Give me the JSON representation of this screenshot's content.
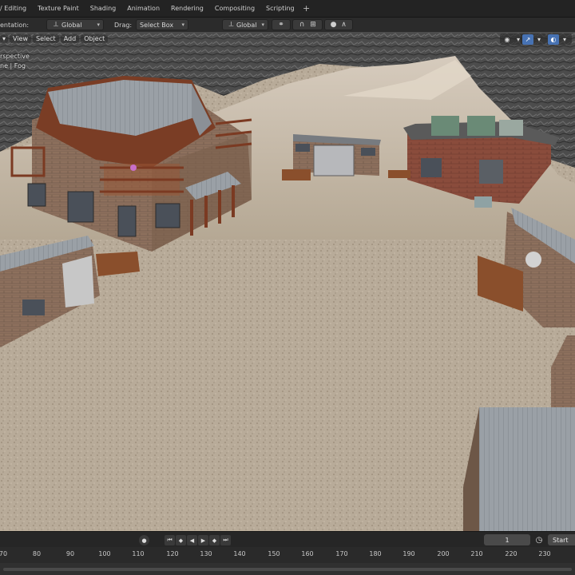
{
  "workspace_tabs": [
    "/ Editing",
    "Texture Paint",
    "Shading",
    "Animation",
    "Rendering",
    "Compositing",
    "Scripting"
  ],
  "header": {
    "orientation_label": "entation:",
    "orientation_value": "Global",
    "drag_label": "Drag:",
    "drag_value": "Select Box",
    "transform_value": "Global"
  },
  "viewport_menu": {
    "view": "View",
    "select": "Select",
    "add": "Add",
    "object": "Object"
  },
  "overlay": {
    "line1": "rspective",
    "line2": "ne | Fog"
  },
  "colors": {
    "sand": "#b7aa98",
    "rock": "#4b4b4b",
    "brick": "#8a6a55",
    "roof": "#9aa0a6",
    "wood": "#7a3d25",
    "active_button": "#4772b3"
  },
  "timeline": {
    "current_frame": "1",
    "start_label": "Start",
    "ruler": [
      "70",
      "80",
      "90",
      "100",
      "110",
      "120",
      "130",
      "140",
      "150",
      "160",
      "170",
      "180",
      "190",
      "200",
      "210",
      "220",
      "230"
    ]
  }
}
